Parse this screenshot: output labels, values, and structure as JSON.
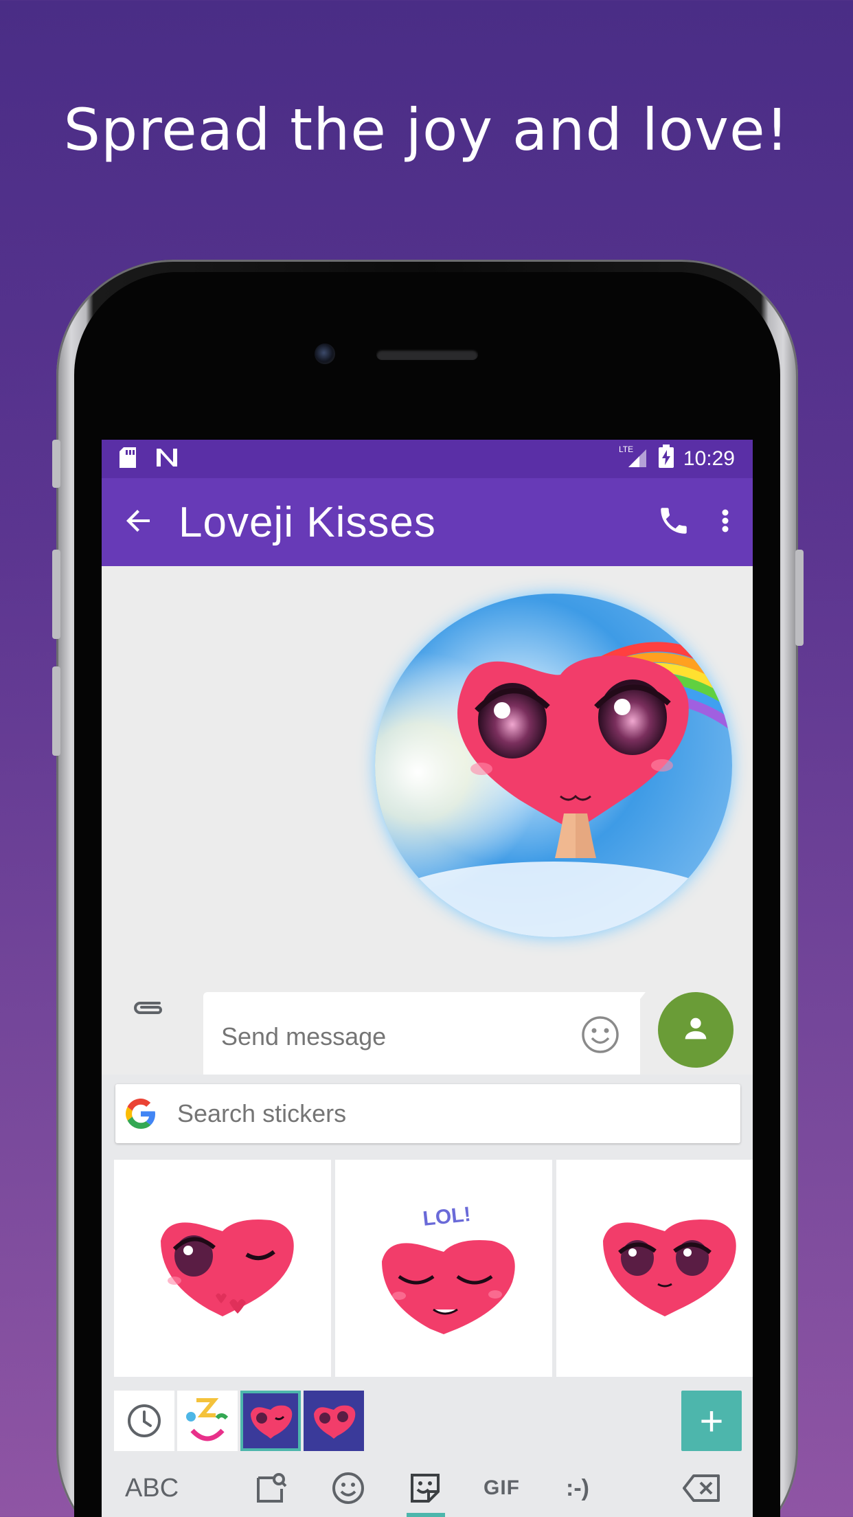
{
  "headline": "Spread the joy and love!",
  "status_bar": {
    "network": "LTE",
    "time": "10:29",
    "icons": [
      "sd-card-icon",
      "n-notification-icon",
      "signal-icon",
      "battery-charging-icon"
    ]
  },
  "app_bar": {
    "title": "Loveji Kisses",
    "icons": [
      "back-arrow-icon",
      "phone-icon",
      "more-vert-icon"
    ]
  },
  "composer": {
    "placeholder": "Send message",
    "icons": [
      "attach-icon",
      "emoji-icon",
      "contact-icon"
    ]
  },
  "keyboard": {
    "search_placeholder": "Search stickers",
    "sticker_labels": [
      "LOL!"
    ],
    "tray_icons": [
      "recent-icon",
      "face-pack-icon",
      "loveji-pack-selected",
      "loveji-pack"
    ],
    "add_label": "+",
    "bottom_bar": {
      "abc_label": "ABC",
      "gif_label": "GIF",
      "emoticon_label": ":-)"
    }
  },
  "colors": {
    "status_bar": "#5a2fa6",
    "app_bar": "#673ab7",
    "send_button": "#6a9c37",
    "accent": "#4db6ac"
  }
}
